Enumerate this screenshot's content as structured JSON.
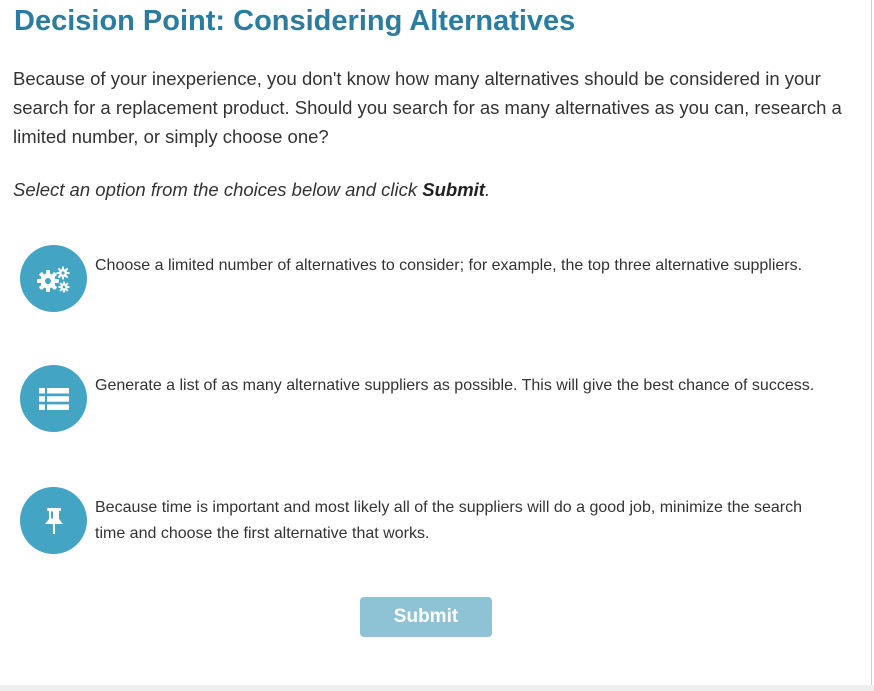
{
  "page": {
    "title": "Decision Point: Considering Alternatives",
    "intro": "Because of your inexperience, you don't know how many alternatives should be considered in your search for a replacement product. Should you search for as many alternatives as you can, research a limited number, or simply choose one?",
    "instruction_prefix": "Select an option from the choices below and click ",
    "instruction_emphasis": "Submit",
    "instruction_suffix": "."
  },
  "options": [
    {
      "icon": "gears-icon",
      "text": "Choose a limited number of alternatives to consider; for example, the top three alternative suppliers."
    },
    {
      "icon": "list-icon",
      "text": "Generate a list of as many alternative suppliers as possible. This will give the best chance of success."
    },
    {
      "icon": "pushpin-icon",
      "text": "Because time is important and most likely all of the suppliers will do a good job, minimize the search time and choose the first alternative that works."
    }
  ],
  "submit_label": "Submit",
  "colors": {
    "title": "#2b7c9e",
    "icon_circle": "#44a4c4",
    "submit_bg": "#8ec3d5"
  }
}
